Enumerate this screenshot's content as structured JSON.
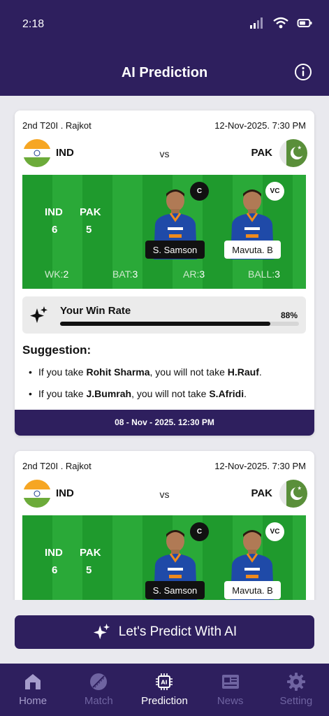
{
  "status": {
    "time": "2:18"
  },
  "header": {
    "title": "AI Prediction"
  },
  "cards": [
    {
      "match": "2nd T20I . Rajkot",
      "datetime": "12-Nov-2025. 7:30 PM",
      "team_a": "IND",
      "vs": "vs",
      "team_b": "PAK",
      "count_labels": [
        "IND",
        "PAK"
      ],
      "counts": [
        "6",
        "5"
      ],
      "captain_badge": "C",
      "captain_name": "S. Samson",
      "vc_badge": "VC",
      "vc_name": "Mavuta. B",
      "positions": [
        {
          "label": "WK:",
          "value": "2"
        },
        {
          "label": "BAT:",
          "value": "3"
        },
        {
          "label": "AR:",
          "value": "3"
        },
        {
          "label": "BALL:",
          "value": "3"
        }
      ],
      "win_rate_label": "Your Win Rate",
      "win_rate_text": "88%",
      "win_rate_value": 0.88,
      "suggestion_title": "Suggestion:",
      "suggestions": [
        {
          "a": "If you take ",
          "b": "Rohit Sharma",
          "c": ", you will not take ",
          "d": "H.Rauf",
          "e": "."
        },
        {
          "a": "If you take ",
          "b": "J.Bumrah",
          "c": ", you will not take ",
          "d": "S.Afridi",
          "e": "."
        }
      ],
      "footer_date": "08 - Nov - 2025. 12:30 PM"
    },
    {
      "match": "2nd T20I . Rajkot",
      "datetime": "12-Nov-2025. 7:30 PM",
      "team_a": "IND",
      "vs": "vs",
      "team_b": "PAK",
      "count_labels": [
        "IND",
        "PAK"
      ],
      "counts": [
        "6",
        "5"
      ],
      "captain_badge": "C",
      "captain_name": "S. Samson",
      "vc_badge": "VC",
      "vc_name": "Mavuta. B"
    }
  ],
  "predict_button": "Let's Predict With AI",
  "nav": [
    {
      "label": "Home",
      "icon": "home-icon"
    },
    {
      "label": "Match",
      "icon": "cricket-ball-icon"
    },
    {
      "label": "Prediction",
      "icon": "ai-chip-icon"
    },
    {
      "label": "News",
      "icon": "news-icon"
    },
    {
      "label": "Setting",
      "icon": "gear-icon"
    }
  ],
  "colors": {
    "primary": "#2e1f5e",
    "pitch": "#1f9a2d"
  }
}
